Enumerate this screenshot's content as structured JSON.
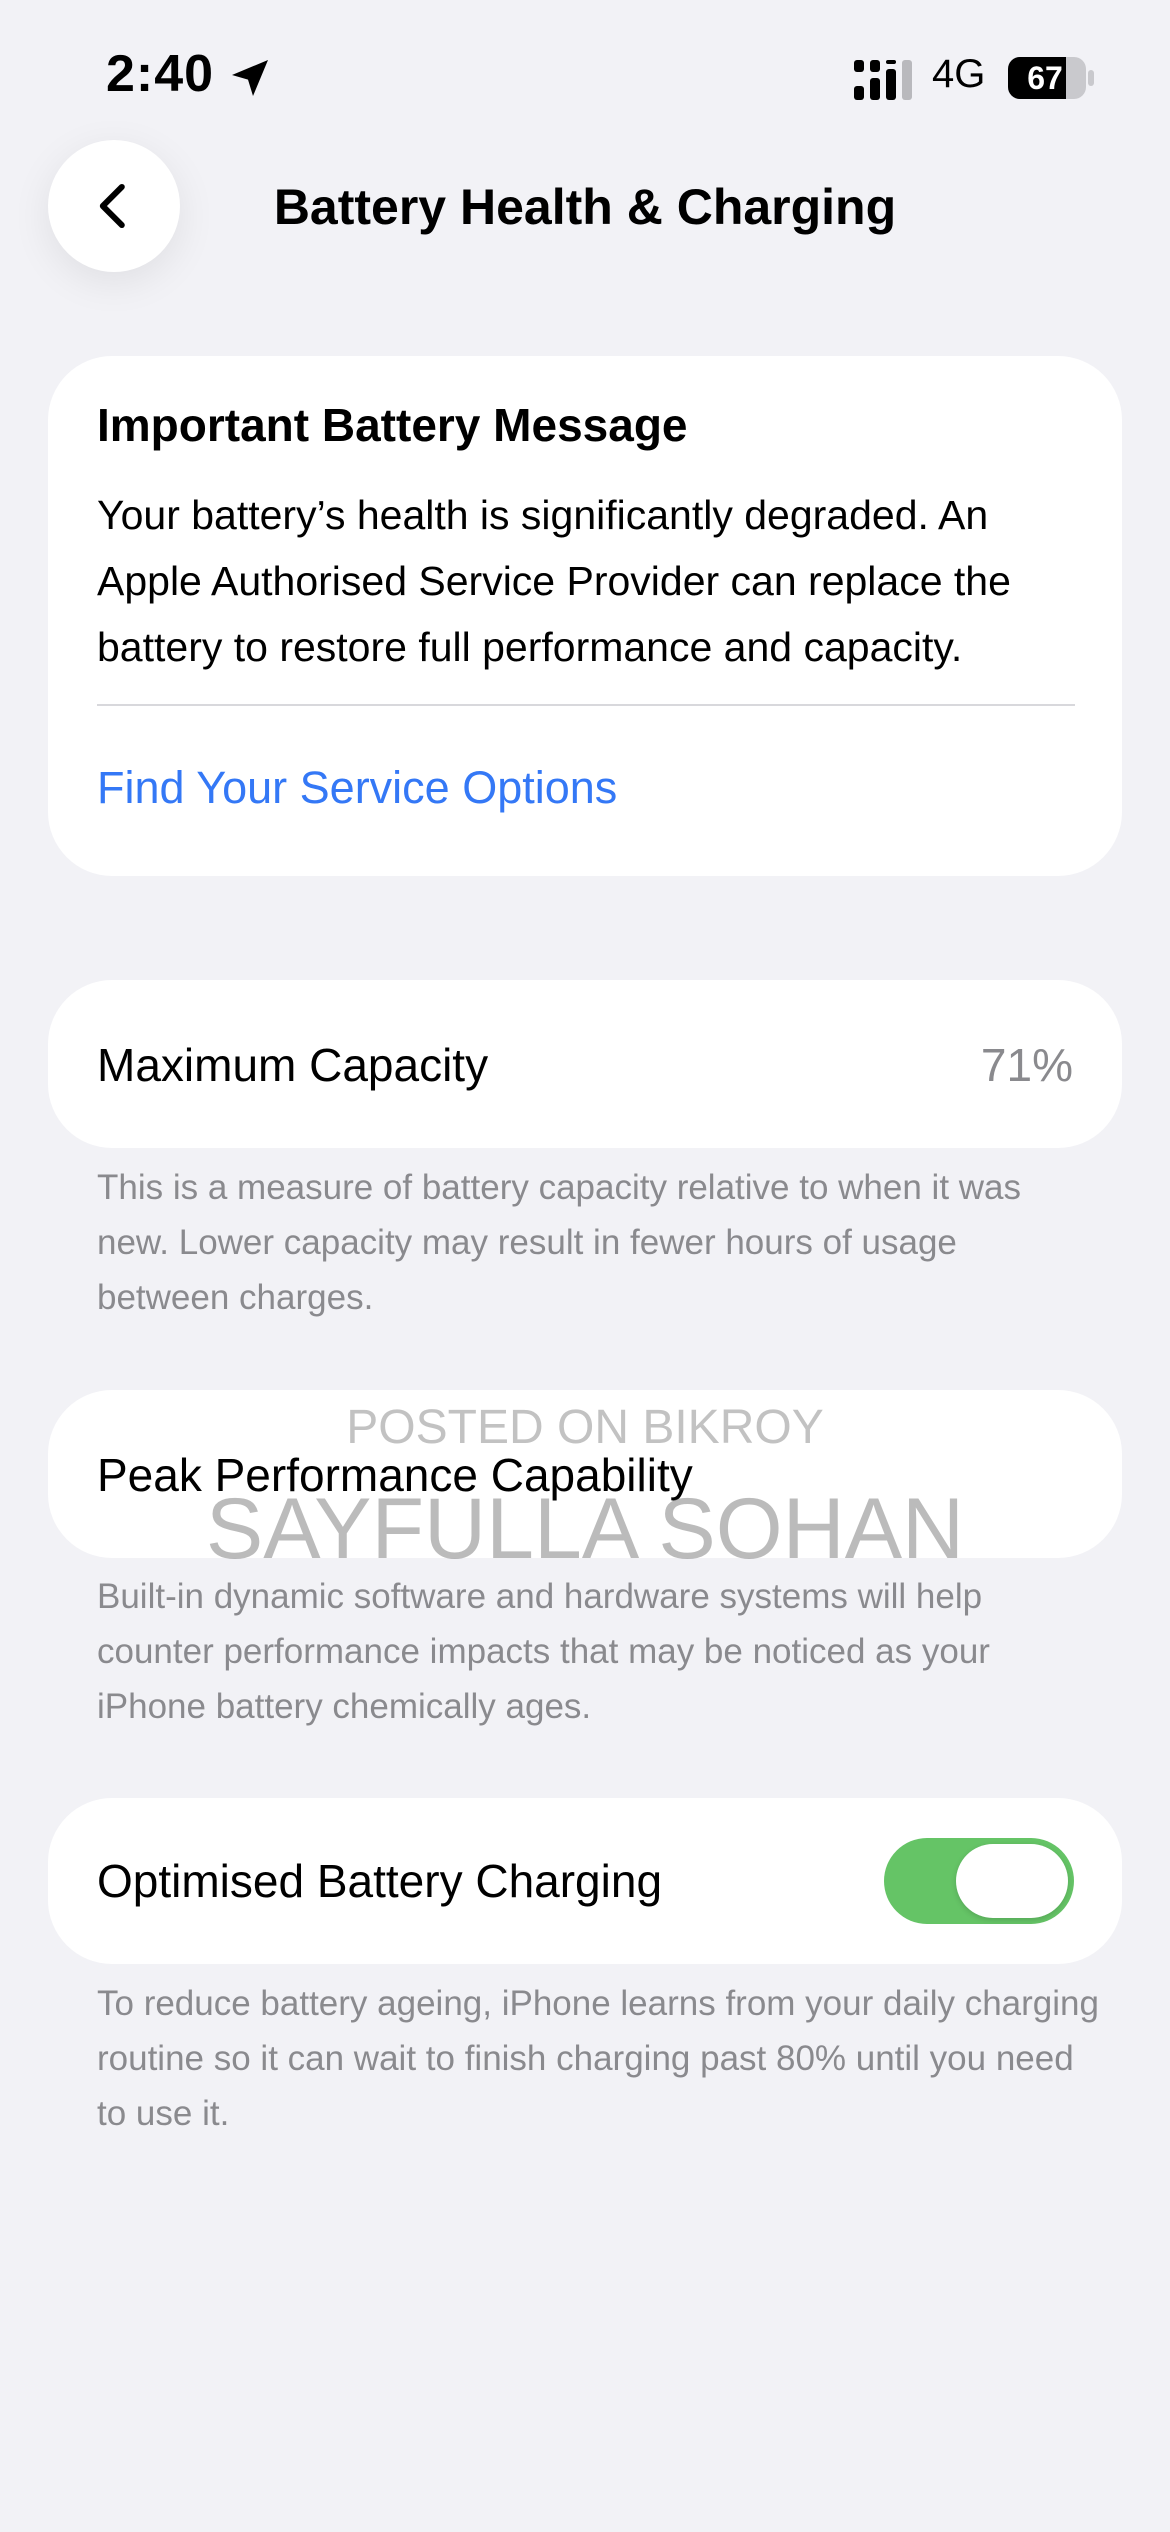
{
  "status_bar": {
    "time": "2:40",
    "network": "4G",
    "battery_level": "67",
    "icons": [
      "location-arrow-icon",
      "cellular-signal-icon",
      "battery-icon"
    ]
  },
  "nav": {
    "title": "Battery Health & Charging",
    "back_icon": "chevron-left-icon"
  },
  "message_card": {
    "title": "Important Battery Message",
    "body": "Your battery’s health is significantly degraded. An Apple Authorised Service Provider can replace the battery to restore full performance and capacity.",
    "link": "Find Your Service Options"
  },
  "maximum_capacity": {
    "label": "Maximum Capacity",
    "value": "71%",
    "description": "This is a measure of battery capacity relative to when it was new. Lower capacity may result in fewer hours of usage between charges."
  },
  "peak_performance": {
    "label": "Peak Performance Capability",
    "description": "Built-in dynamic software and hardware systems will help counter performance impacts that may be noticed as your iPhone battery chemically ages."
  },
  "optimised_charging": {
    "label": "Optimised Battery Charging",
    "enabled": true,
    "description": "To reduce battery ageing, iPhone learns from your daily charging routine so it can wait to finish charging past 80% until you need to use it."
  },
  "watermark": {
    "line1": "POSTED ON BIKROY",
    "line2": "SAYFULLA SOHAN"
  },
  "colors": {
    "link": "#3478f6",
    "toggle_on": "#65c466",
    "background": "#f2f2f6",
    "secondary_text": "#8a8a8e"
  }
}
